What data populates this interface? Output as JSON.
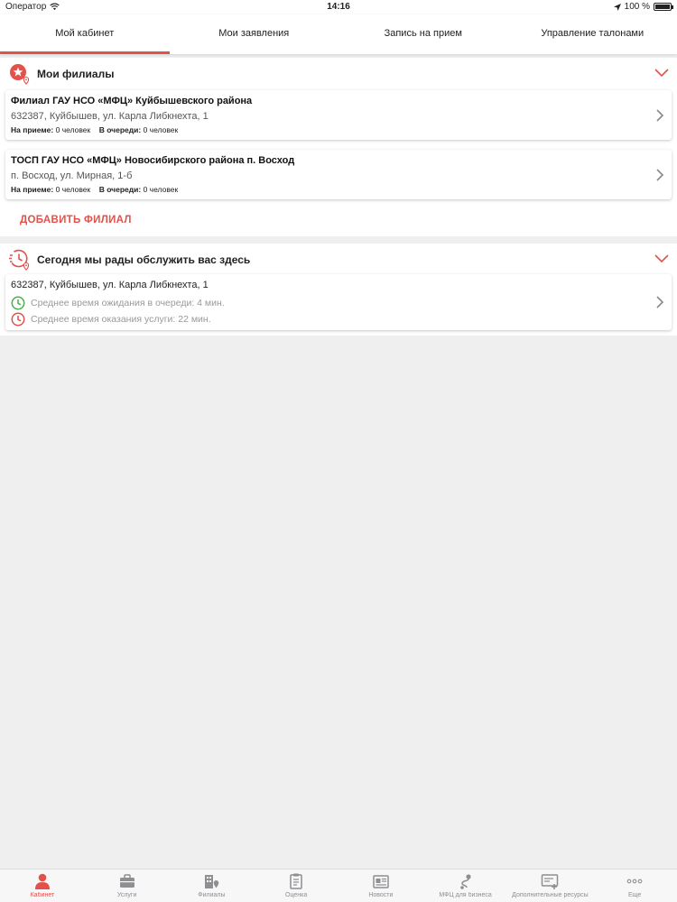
{
  "status_bar": {
    "carrier": "Оператор",
    "time": "14:16",
    "battery": "100 %"
  },
  "tabs": [
    {
      "label": "Мой кабинет",
      "active": true
    },
    {
      "label": "Мои заявления",
      "active": false
    },
    {
      "label": "Запись на прием",
      "active": false
    },
    {
      "label": "Управление талонами",
      "active": false
    }
  ],
  "my_branches": {
    "title": "Мои филиалы",
    "branches": [
      {
        "name": "Филиал ГАУ НСО «МФЦ» Куйбышевского района",
        "address": "632387, Куйбышев, ул. Карла Либкнехта, 1",
        "reception_label": "На приеме:",
        "reception_value": "0 человек",
        "queue_label": "В очереди:",
        "queue_value": "0 человек"
      },
      {
        "name": "ТОСП ГАУ НСО «МФЦ» Новосибирского района п. Восход",
        "address": "п. Восход, ул. Мирная, 1-б",
        "reception_label": "На приеме:",
        "reception_value": "0 человек",
        "queue_label": "В очереди:",
        "queue_value": "0 человек"
      }
    ],
    "add_button": "ДОБАВИТЬ ФИЛИАЛ"
  },
  "today": {
    "title": "Сегодня мы рады обслужить вас здесь",
    "address": "632387, Куйбышев, ул. Карла Либкнехта, 1",
    "wait_time": "Среднее время ожидания в очереди: 4 мин.",
    "service_time": "Среднее время оказания услуги: 22 мин."
  },
  "bottom_nav": [
    {
      "label": "Кабинет",
      "icon": "person-icon",
      "active": true
    },
    {
      "label": "Услуги",
      "icon": "briefcase-icon",
      "active": false
    },
    {
      "label": "Филиалы",
      "icon": "building-pin-icon",
      "active": false
    },
    {
      "label": "Оценка",
      "icon": "clipboard-icon",
      "active": false
    },
    {
      "label": "Новости",
      "icon": "newspaper-icon",
      "active": false
    },
    {
      "label": "МФЦ для бизнеса",
      "icon": "route-icon",
      "active": false
    },
    {
      "label": "Дополнительные ресурсы",
      "icon": "resources-icon",
      "active": false
    },
    {
      "label": "Еще",
      "icon": "more-icon",
      "active": false
    }
  ],
  "colors": {
    "accent": "#e2514a",
    "green": "#4caf50",
    "background": "#efefef",
    "inactive": "#8e8e93"
  }
}
